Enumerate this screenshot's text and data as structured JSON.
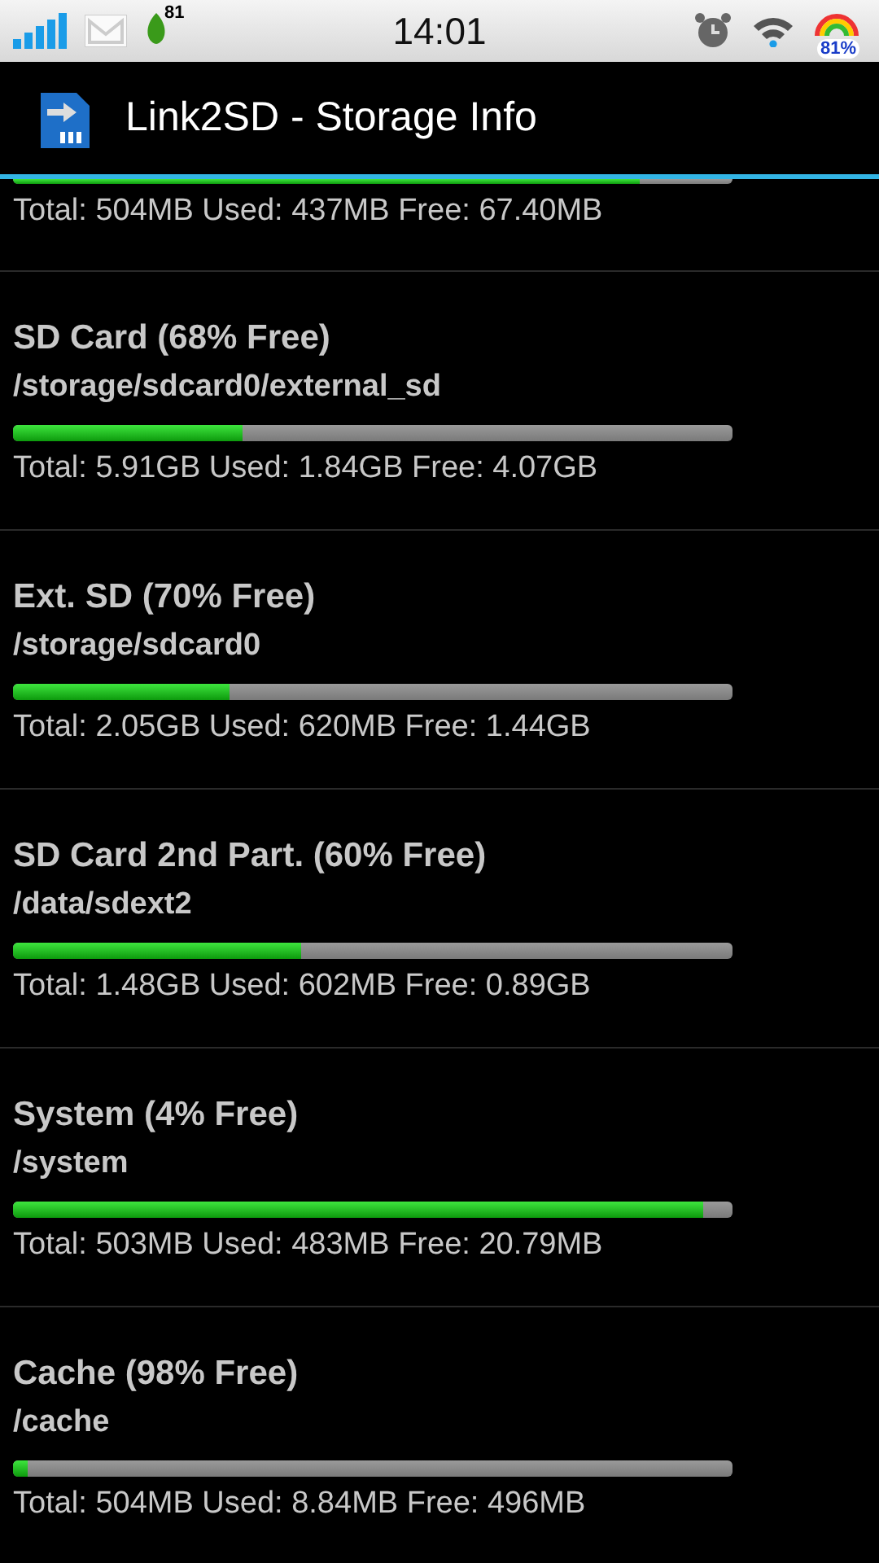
{
  "status_bar": {
    "notification_count": "81",
    "time": "14:01",
    "battery": "81%"
  },
  "action_bar": {
    "title": "Link2SD - Storage Info"
  },
  "storages": [
    {
      "kind": "partial",
      "level": 0.87,
      "totals": "Total: 504MB Used: 437MB Free: 67.40MB"
    },
    {
      "kind": "full",
      "name": "SD Card (68% Free)",
      "path": "/storage/sdcard0/external_sd",
      "level": 0.32,
      "totals": "Total: 5.91GB Used: 1.84GB Free: 4.07GB"
    },
    {
      "kind": "full",
      "name": "Ext. SD (70% Free)",
      "path": "/storage/sdcard0",
      "level": 0.3,
      "totals": "Total: 2.05GB Used: 620MB Free: 1.44GB"
    },
    {
      "kind": "full",
      "name": "SD Card 2nd Part. (60% Free)",
      "path": "/data/sdext2",
      "level": 0.4,
      "totals": "Total: 1.48GB Used: 602MB Free: 0.89GB"
    },
    {
      "kind": "full",
      "name": "System (4% Free)",
      "path": "/system",
      "level": 0.96,
      "totals": "Total: 503MB Used: 483MB Free: 20.79MB"
    },
    {
      "kind": "full",
      "name": "Cache (98% Free)",
      "path": "/cache",
      "level": 0.02,
      "totals": "Total: 504MB Used: 8.84MB Free: 496MB"
    }
  ]
}
